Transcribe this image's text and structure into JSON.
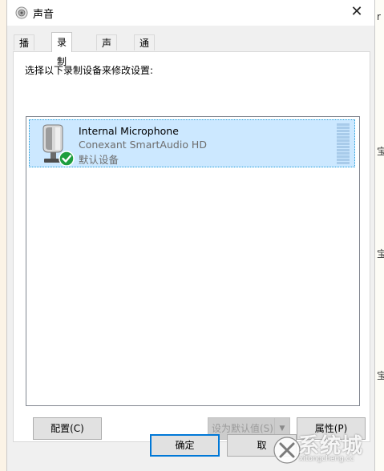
{
  "window": {
    "title": "声音",
    "close_glyph": "✕"
  },
  "tabs": [
    {
      "label": "播放",
      "active": false
    },
    {
      "label": "录制",
      "active": true
    },
    {
      "label": "声音",
      "active": false
    },
    {
      "label": "通信",
      "active": false
    }
  ],
  "panel": {
    "instruction": "选择以下录制设备来修改设置:"
  },
  "devices": [
    {
      "name": "Internal Microphone",
      "driver": "Conexant SmartAudio HD",
      "status": "默认设备",
      "icon": "microphone-icon",
      "status_badge": "default-device-check-icon"
    }
  ],
  "buttons": {
    "configure": "配置(C)",
    "set_default": "设为默认值(S)",
    "properties": "属性(P)",
    "ok": "确定",
    "cancel": "取"
  },
  "background": {
    "right_chars": [
      "r",
      "宝",
      "宝",
      "宝"
    ]
  },
  "watermark": {
    "text": "系统城",
    "url": "xitongcheng.cc"
  },
  "colors": {
    "selection": "#cce8ff",
    "selection_border": "#26a0da",
    "default_button_border": "#0078d7",
    "check_green": "#1e9e3e"
  }
}
